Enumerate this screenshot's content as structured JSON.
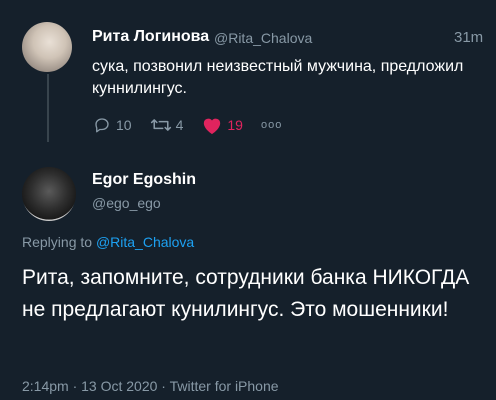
{
  "parent_tweet": {
    "display_name": "Рита Логинова",
    "handle": "@Rita_Chalova",
    "time": "31m",
    "text": "сука, позвонил неизвестный мужчина, предложил куннилингус.",
    "replies": "10",
    "retweets": "4",
    "likes": "19",
    "more": "ооо"
  },
  "reply_tweet": {
    "display_name": "Egor Egoshin",
    "handle": "@ego_ego",
    "replying_prefix": "Replying to",
    "replying_handle": "@Rita_Chalova",
    "text": "Рита, запомните, сотрудники банка НИКОГДА не предлагают кунилингус. Это мошенники!",
    "meta": "2:14pm · 13 Oct 2020 · Twitter for iPhone"
  },
  "colors": {
    "background": "#15202b",
    "secondary_text": "#8899a6",
    "link": "#1da1f2",
    "like": "#e0245e"
  }
}
